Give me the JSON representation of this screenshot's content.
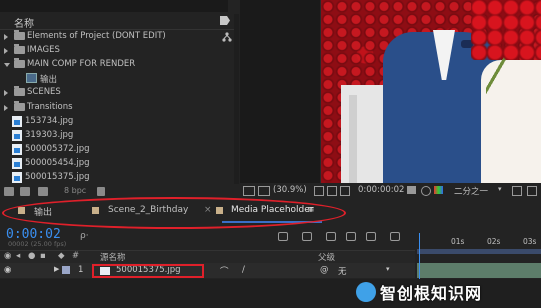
{
  "project": {
    "header_label": "名称",
    "items": [
      {
        "type": "folder",
        "expanded": false,
        "label": "Elements of Project (DONT EDIT)"
      },
      {
        "type": "folder",
        "expanded": false,
        "label": "IMAGES"
      },
      {
        "type": "folder",
        "expanded": true,
        "label": "MAIN COMP FOR RENDER"
      },
      {
        "type": "comp",
        "label": "输出"
      },
      {
        "type": "folder",
        "expanded": false,
        "label": "SCENES"
      },
      {
        "type": "folder",
        "expanded": false,
        "label": "Transitions"
      },
      {
        "type": "image",
        "label": "153734.jpg"
      },
      {
        "type": "image",
        "label": "319303.jpg"
      },
      {
        "type": "image",
        "label": "500005372.jpg"
      },
      {
        "type": "image",
        "label": "500005454.jpg"
      },
      {
        "type": "image",
        "label": "500015375.jpg"
      }
    ],
    "footer_bpc": "8 bpc"
  },
  "viewer": {
    "zoom": "(30.9%)",
    "timecode": "0:00:00:02",
    "resolution": "二分之一"
  },
  "tabs": [
    {
      "label": "输出",
      "color": "#c8b08a",
      "active": false
    },
    {
      "label": "Scene_2_Birthday",
      "color": "#c8b08a",
      "active": false
    },
    {
      "label": "Media Placeholder",
      "color": "#c8b08a",
      "active": true
    }
  ],
  "timeline": {
    "timecode": "0:00:02",
    "fps": "00002 (25.00 fps)",
    "search_placeholder": "ρ·",
    "columns": {
      "name": "源名称",
      "parent": "父级"
    },
    "layer": {
      "index": "1",
      "name": "500015375.jpg",
      "parent": "无"
    },
    "ruler_ticks": [
      "01s",
      "02s",
      "03s"
    ]
  },
  "watermark": "智创根知识网"
}
